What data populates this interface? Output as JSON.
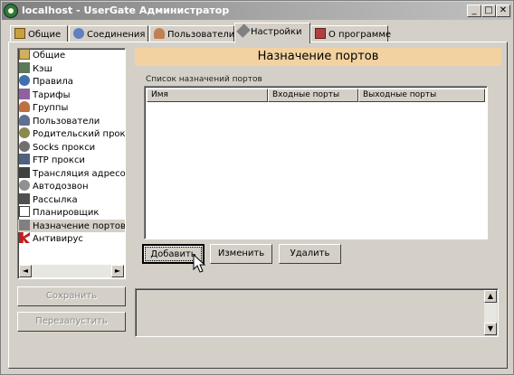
{
  "window": {
    "title": "localhost - UserGate Администратор",
    "min": "_",
    "max": "□",
    "close": "✕"
  },
  "tabs": [
    {
      "label": "Общие"
    },
    {
      "label": "Соединения"
    },
    {
      "label": "Пользователи"
    },
    {
      "label": "Настройки"
    },
    {
      "label": "О программе"
    }
  ],
  "tree": {
    "items": [
      {
        "label": "Общие"
      },
      {
        "label": "Кэш"
      },
      {
        "label": "Правила"
      },
      {
        "label": "Тарифы"
      },
      {
        "label": "Группы"
      },
      {
        "label": "Пользователи"
      },
      {
        "label": "Родительский прокси"
      },
      {
        "label": "Socks прокси"
      },
      {
        "label": "FTP прокси"
      },
      {
        "label": "Трансляция адресов"
      },
      {
        "label": "Автодозвон"
      },
      {
        "label": "Рассылка"
      },
      {
        "label": "Планировщик"
      },
      {
        "label": "Назначение портов"
      },
      {
        "label": "Антивирус"
      }
    ],
    "scroll_left": "◄",
    "scroll_right": "►"
  },
  "page": {
    "header": "Назначение портов",
    "list_caption": "Список назначений портов",
    "columns": [
      "Имя",
      "Входные порты",
      "Выходные порты"
    ]
  },
  "actions": {
    "add": "Добавить",
    "edit": "Изменить",
    "delete": "Удалить",
    "save": "Сохранить",
    "restart": "Перезапустить"
  },
  "log": {
    "scroll_up": "▲",
    "scroll_down": "▼"
  }
}
